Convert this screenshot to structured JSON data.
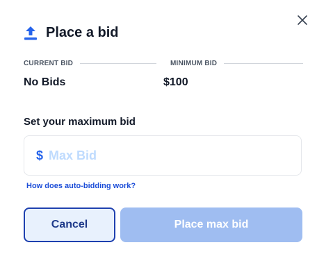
{
  "modal": {
    "title": "Place a bid",
    "icon": "upload-icon",
    "close_icon": "close-icon",
    "accent_color": "#2563eb"
  },
  "bid_info": {
    "current_label": "CURRENT BID",
    "current_value": "No Bids",
    "minimum_label": "MINIMUM BID",
    "minimum_value": "$100"
  },
  "max_bid": {
    "label": "Set your maximum bid",
    "currency_symbol": "$",
    "placeholder": "Max Bid",
    "value": ""
  },
  "help_link": "How does auto-bidding work?",
  "buttons": {
    "cancel": "Cancel",
    "submit": "Place max bid",
    "submit_disabled": true
  }
}
